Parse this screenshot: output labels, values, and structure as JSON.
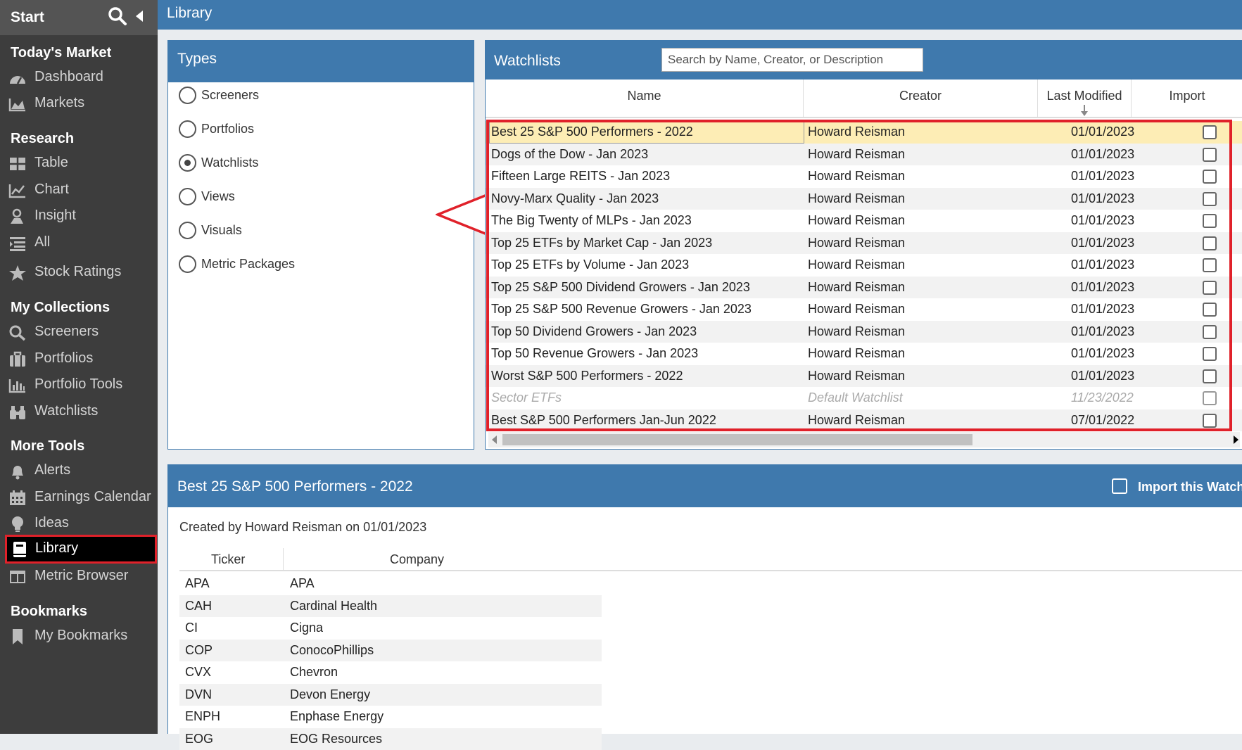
{
  "sidebar": {
    "start_label": "Start",
    "sections": [
      {
        "title": "Today's Market",
        "items": [
          {
            "label": "Dashboard",
            "icon": "dashboard-icon"
          },
          {
            "label": "Markets",
            "icon": "area-chart-icon"
          }
        ]
      },
      {
        "title": "Research",
        "items": [
          {
            "label": "Table",
            "icon": "table-icon"
          },
          {
            "label": "Chart",
            "icon": "line-chart-icon"
          },
          {
            "label": "Insight",
            "icon": "insight-icon"
          },
          {
            "label": "All",
            "icon": "list-icon"
          },
          {
            "label": "Stock Ratings",
            "icon": "star-icon"
          }
        ]
      },
      {
        "title": "My Collections",
        "items": [
          {
            "label": "Screeners",
            "icon": "search-icon"
          },
          {
            "label": "Portfolios",
            "icon": "briefcase-icon"
          },
          {
            "label": "Portfolio Tools",
            "icon": "bar-chart-icon"
          },
          {
            "label": "Watchlists",
            "icon": "binoculars-icon"
          }
        ]
      },
      {
        "title": "More Tools",
        "items": [
          {
            "label": "Alerts",
            "icon": "bell-icon"
          },
          {
            "label": "Earnings Calendar",
            "icon": "calendar-icon"
          },
          {
            "label": "Ideas",
            "icon": "lightbulb-icon"
          },
          {
            "label": "Library",
            "icon": "book-icon",
            "active": true
          },
          {
            "label": "Metric Browser",
            "icon": "columns-icon"
          }
        ]
      },
      {
        "title": "Bookmarks",
        "items": [
          {
            "label": "My Bookmarks",
            "icon": "bookmark-icon"
          }
        ]
      }
    ]
  },
  "page": {
    "title": "Library"
  },
  "types": {
    "title": "Types",
    "options": [
      {
        "label": "Screeners",
        "selected": false
      },
      {
        "label": "Portfolios",
        "selected": false
      },
      {
        "label": "Watchlists",
        "selected": true
      },
      {
        "label": "Views",
        "selected": false
      },
      {
        "label": "Visuals",
        "selected": false
      },
      {
        "label": "Metric Packages",
        "selected": false
      }
    ]
  },
  "watchlists": {
    "title": "Watchlists",
    "search_placeholder": "Search by Name, Creator, or Description",
    "columns": {
      "name": "Name",
      "creator": "Creator",
      "last_modified": "Last Modified",
      "import": "Import"
    },
    "rows": [
      {
        "name": "Best 25 S&P 500 Performers - 2022",
        "creator": "Howard Reisman",
        "modified": "01/01/2023",
        "selected": true
      },
      {
        "name": "Dogs of the Dow - Jan 2023",
        "creator": "Howard Reisman",
        "modified": "01/01/2023"
      },
      {
        "name": "Fifteen Large REITS - Jan 2023",
        "creator": "Howard Reisman",
        "modified": "01/01/2023"
      },
      {
        "name": "Novy-Marx Quality - Jan 2023",
        "creator": "Howard Reisman",
        "modified": "01/01/2023"
      },
      {
        "name": "The Big Twenty of MLPs - Jan 2023",
        "creator": "Howard Reisman",
        "modified": "01/01/2023"
      },
      {
        "name": "Top 25 ETFs by Market Cap - Jan 2023",
        "creator": "Howard Reisman",
        "modified": "01/01/2023"
      },
      {
        "name": "Top 25 ETFs by Volume - Jan 2023",
        "creator": "Howard Reisman",
        "modified": "01/01/2023"
      },
      {
        "name": "Top 25 S&P 500 Dividend Growers - Jan 2023",
        "creator": "Howard Reisman",
        "modified": "01/01/2023"
      },
      {
        "name": "Top 25 S&P 500 Revenue Growers - Jan 2023",
        "creator": "Howard Reisman",
        "modified": "01/01/2023"
      },
      {
        "name": "Top 50 Dividend Growers - Jan 2023",
        "creator": "Howard Reisman",
        "modified": "01/01/2023"
      },
      {
        "name": "Top 50 Revenue Growers - Jan 2023",
        "creator": "Howard Reisman",
        "modified": "01/01/2023"
      },
      {
        "name": "Worst S&P 500 Performers - 2022",
        "creator": "Howard Reisman",
        "modified": "01/01/2023"
      },
      {
        "name": "Sector ETFs",
        "creator": "Default Watchlist",
        "modified": "11/23/2022",
        "muted": true
      },
      {
        "name": "Best S&P 500 Performers Jan-Jun 2022",
        "creator": "Howard Reisman",
        "modified": "07/01/2022"
      }
    ]
  },
  "detail": {
    "title": "Best 25 S&P 500 Performers - 2022",
    "import_label": "Import this Watchli",
    "created_by": "Created by Howard Reisman on 01/01/2023",
    "columns": {
      "ticker": "Ticker",
      "company": "Company"
    },
    "rows": [
      {
        "ticker": "APA",
        "company": "APA"
      },
      {
        "ticker": "CAH",
        "company": "Cardinal Health"
      },
      {
        "ticker": "CI",
        "company": "Cigna"
      },
      {
        "ticker": "COP",
        "company": "ConocoPhillips"
      },
      {
        "ticker": "CVX",
        "company": "Chevron"
      },
      {
        "ticker": "DVN",
        "company": "Devon Energy"
      },
      {
        "ticker": "ENPH",
        "company": "Enphase Energy"
      },
      {
        "ticker": "EOG",
        "company": "EOG Resources"
      }
    ]
  },
  "colors": {
    "brand_blue": "#3f79ad",
    "highlight_red": "#e0212a",
    "selected_row": "#fdedb5"
  }
}
